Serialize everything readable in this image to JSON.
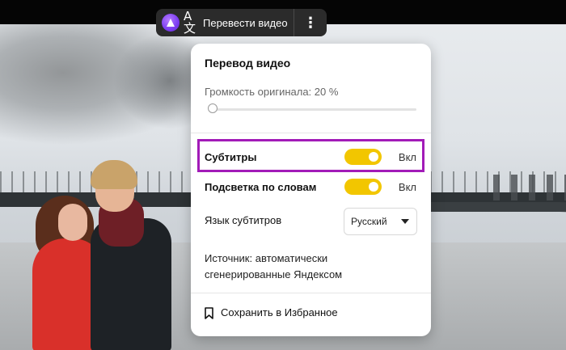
{
  "pill": {
    "label": "Перевести видео",
    "translate_glyph": "A文",
    "more_glyph": "⋮",
    "icons": {
      "assistant": "alice-icon",
      "translate": "translate-icon",
      "more": "more-vertical-icon"
    }
  },
  "panel": {
    "title": "Перевод видео",
    "volume": {
      "label": "Громкость оригинала: 20 %",
      "value_percent": 20
    },
    "subtitles": {
      "label": "Субтитры",
      "state": "Вкл",
      "enabled": true
    },
    "word_highlight": {
      "label": "Подсветка по словам",
      "state": "Вкл",
      "enabled": true
    },
    "subtitle_language": {
      "label": "Язык субтитров",
      "selected": "Русский"
    },
    "source": "Источник: автоматически\nсгенерированные Яндексом",
    "save": {
      "label": "Сохранить в Избранное",
      "icon": "bookmark-icon"
    }
  },
  "colors": {
    "toggle_on": "#f2c600",
    "highlight_frame": "#a21bb8",
    "assistant": "#7b3cf0"
  }
}
